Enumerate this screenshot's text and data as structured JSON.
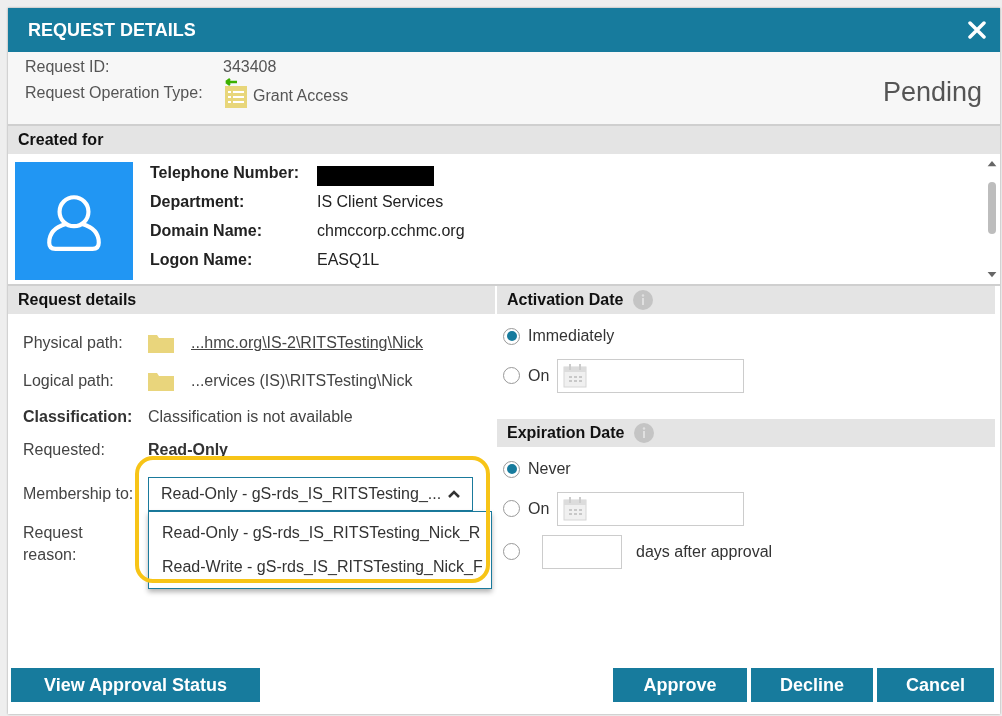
{
  "dialog": {
    "title": "REQUEST DETAILS"
  },
  "request": {
    "id_label": "Request ID:",
    "id": "343408",
    "type_label": "Request Operation Type:",
    "type": "Grant Access",
    "status": "Pending"
  },
  "created_for": {
    "heading": "Created for",
    "fields": [
      {
        "label": "Telephone Number:",
        "redacted": true
      },
      {
        "label": "Department:",
        "redacted": false,
        "value": "IS Client Services"
      },
      {
        "label": "Domain Name:",
        "redacted": false,
        "value": "chmccorp.cchmc.org"
      },
      {
        "label": "Logon Name:",
        "redacted": false,
        "value": "EASQ1L"
      }
    ]
  },
  "request_details": {
    "heading": "Request details",
    "rows": [
      {
        "kind": "path",
        "label": "Physical path:",
        "value": "...hmc.org\\IS-2\\RITSTesting\\Nick",
        "link": true,
        "bold_label": false,
        "bold_value": false
      },
      {
        "kind": "path",
        "label": "Logical path:",
        "value": "...ervices (IS)\\RITSTesting\\Nick",
        "link": false,
        "bold_label": false,
        "bold_value": false
      },
      {
        "kind": "text",
        "label": "Classification:",
        "value": "Classification is not available",
        "link": false,
        "bold_label": true,
        "bold_value": false
      },
      {
        "kind": "text",
        "label": "Requested:",
        "value": "Read-Only",
        "link": false,
        "bold_label": false,
        "bold_value": true
      }
    ],
    "membership": {
      "label": "Membership to:",
      "value": "Read-Only - gS-rds_IS_RITSTesting_...",
      "expanded": true,
      "highlighted": true,
      "options": [
        {
          "label": "Read-Only - gS-rds_IS_RITSTesting_Nick_R"
        },
        {
          "label": "Read-Write - gS-rds_IS_RITSTesting_Nick_F"
        }
      ]
    },
    "reason_label": "Request reason:"
  },
  "activation": {
    "heading": "Activation Date",
    "options": [
      {
        "kind": "plain",
        "label": "Immediately",
        "selected": true
      },
      {
        "kind": "date",
        "label": "On",
        "selected": false
      }
    ]
  },
  "expiration": {
    "heading": "Expiration Date",
    "options": [
      {
        "kind": "plain",
        "label": "Never",
        "selected": true
      },
      {
        "kind": "date",
        "label": "On",
        "selected": false
      },
      {
        "kind": "days",
        "label": "days after approval",
        "selected": false
      }
    ]
  },
  "buttons_left": [
    "View Approval Status"
  ],
  "buttons_right": [
    "Approve",
    "Decline",
    "Cancel"
  ]
}
